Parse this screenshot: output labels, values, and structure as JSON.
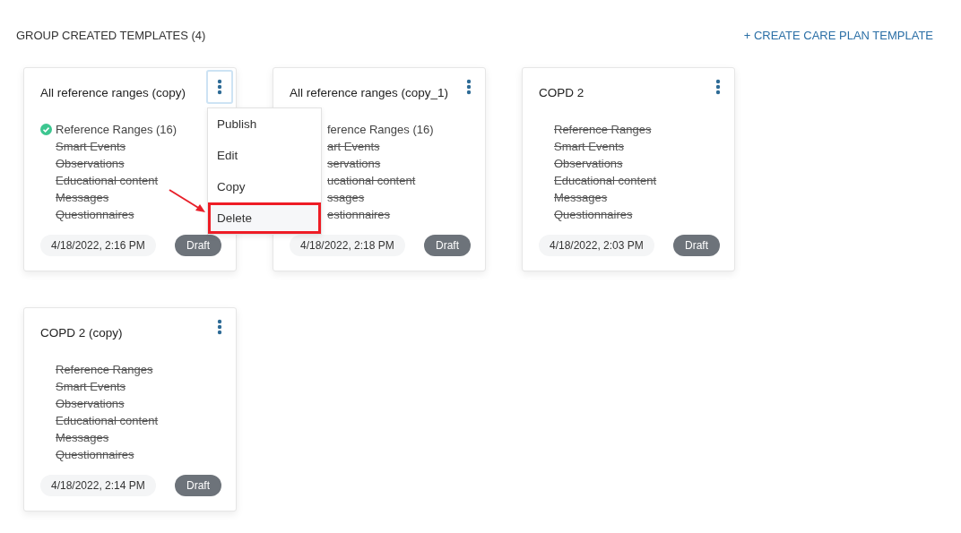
{
  "header": {
    "title": "GROUP CREATED TEMPLATES (4)",
    "action": "+ CREATE CARE PLAN TEMPLATE"
  },
  "cards": [
    {
      "title": "All reference ranges (copy)",
      "menu_focused": true,
      "items": [
        {
          "label": "Reference Ranges (16)",
          "included": true,
          "covered": false
        },
        {
          "label": "Smart Events",
          "included": false,
          "covered": false
        },
        {
          "label": "Observations",
          "included": false,
          "covered": false
        },
        {
          "label": "Educational content",
          "included": false,
          "covered": false
        },
        {
          "label": "Messages",
          "included": false,
          "covered": false
        },
        {
          "label": "Questionnaires",
          "included": false,
          "covered": false
        }
      ],
      "date": "4/18/2022, 2:16 PM",
      "status": "Draft"
    },
    {
      "title": "All reference ranges (copy_1)",
      "menu_focused": false,
      "items": [
        {
          "label": "ference Ranges (16)",
          "included": true,
          "covered": true
        },
        {
          "label": "art Events",
          "included": false,
          "covered": true
        },
        {
          "label": "servations",
          "included": false,
          "covered": true
        },
        {
          "label": "ucational content",
          "included": false,
          "covered": true
        },
        {
          "label": "ssages",
          "included": false,
          "covered": true
        },
        {
          "label": "estionnaires",
          "included": false,
          "covered": true
        }
      ],
      "date": "4/18/2022, 2:18 PM",
      "status": "Draft"
    },
    {
      "title": "COPD 2",
      "menu_focused": false,
      "items": [
        {
          "label": "Reference Ranges",
          "included": false,
          "covered": false
        },
        {
          "label": "Smart Events",
          "included": false,
          "covered": false
        },
        {
          "label": "Observations",
          "included": false,
          "covered": false
        },
        {
          "label": "Educational content",
          "included": false,
          "covered": false
        },
        {
          "label": "Messages",
          "included": false,
          "covered": false
        },
        {
          "label": "Questionnaires",
          "included": false,
          "covered": false
        }
      ],
      "date": "4/18/2022, 2:03 PM",
      "status": "Draft"
    },
    {
      "title": "COPD 2 (copy)",
      "menu_focused": false,
      "items": [
        {
          "label": "Reference Ranges",
          "included": false,
          "covered": false
        },
        {
          "label": "Smart Events",
          "included": false,
          "covered": false
        },
        {
          "label": "Observations",
          "included": false,
          "covered": false
        },
        {
          "label": "Educational content",
          "included": false,
          "covered": false
        },
        {
          "label": "Messages",
          "included": false,
          "covered": false
        },
        {
          "label": "Questionnaires",
          "included": false,
          "covered": false
        }
      ],
      "date": "4/18/2022, 2:14 PM",
      "status": "Draft"
    }
  ],
  "menu": {
    "items": [
      {
        "label": "Publish",
        "selected": false
      },
      {
        "label": "Edit",
        "selected": false
      },
      {
        "label": "Copy",
        "selected": false
      },
      {
        "label": "Delete",
        "selected": true
      }
    ]
  }
}
